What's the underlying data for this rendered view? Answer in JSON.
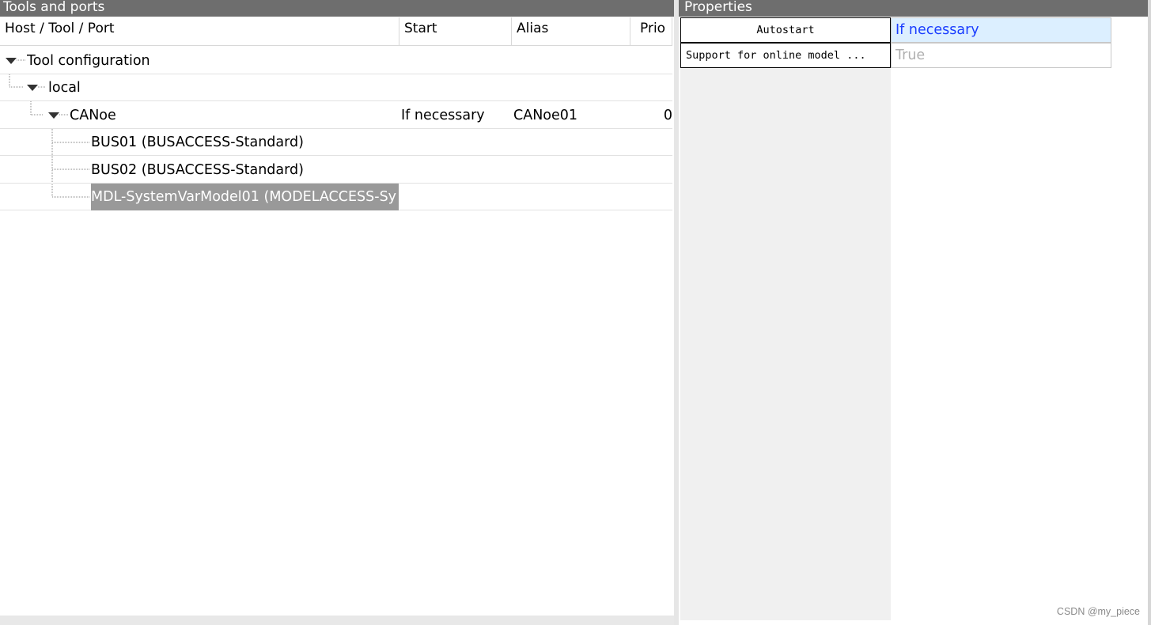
{
  "left_panel": {
    "title": "Tools and ports",
    "columns": [
      "Host / Tool / Port",
      "Start",
      "Alias",
      "Prio"
    ],
    "rows": [
      {
        "label": "Tool configuration",
        "start": "",
        "alias": "",
        "prio": ""
      },
      {
        "label": "local",
        "start": "",
        "alias": "",
        "prio": ""
      },
      {
        "label": "CANoe",
        "start": "If necessary",
        "alias": "CANoe01",
        "prio": "0"
      },
      {
        "label": "BUS01 (BUSACCESS-Standard)",
        "start": "",
        "alias": "",
        "prio": ""
      },
      {
        "label": "BUS02 (BUSACCESS-Standard)",
        "start": "",
        "alias": "",
        "prio": ""
      },
      {
        "label": "MDL-SystemVarModel01 (MODELACCESS-Sy",
        "start": "",
        "alias": "",
        "prio": "",
        "selected": true
      }
    ]
  },
  "right_panel": {
    "title": "Properties",
    "properties": [
      {
        "name": "Autostart",
        "value": "If necessary"
      },
      {
        "name": "Support for online model ...",
        "value": "True"
      }
    ]
  },
  "watermark": "CSDN @my_piece",
  "colors": {
    "titlebar": "#6e6e6e",
    "selected_row": "#999999",
    "property_value_highlight": "#dcefff",
    "property_value_text": "#1a3dff",
    "disabled_text": "#b0b0b0"
  }
}
